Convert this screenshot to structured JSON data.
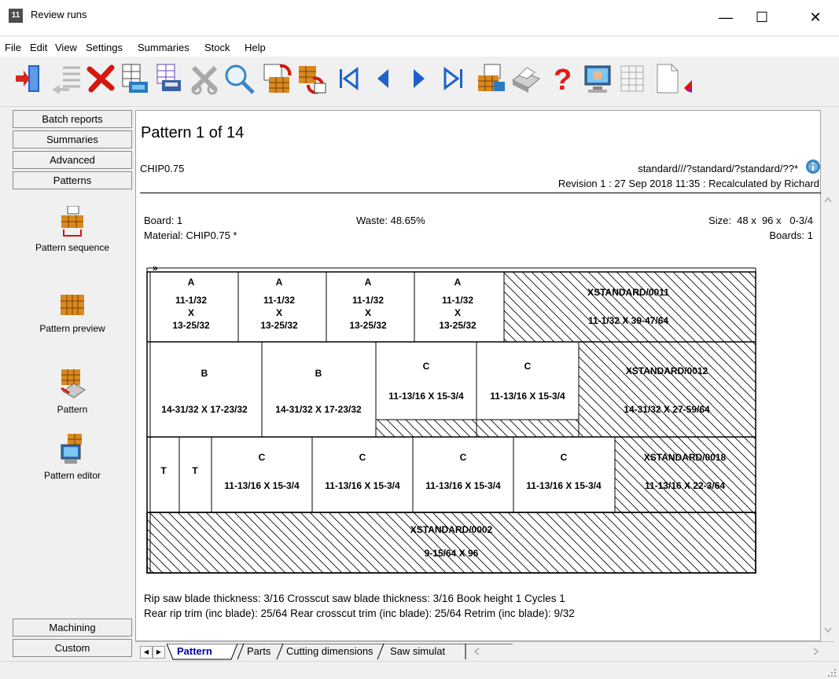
{
  "window": {
    "title": "Review runs",
    "app_icon_text": "11",
    "controls": {
      "minimize": "—",
      "maximize": "☐",
      "close": "✕"
    }
  },
  "menu": [
    "File",
    "Edit",
    "View",
    "Settings",
    "Summaries",
    "Stock",
    "Help"
  ],
  "toolbar": [
    "exit-icon",
    "list-icon",
    "delete-icon",
    "grid-icon",
    "print-grid-icon",
    "cut-icon",
    "search-icon",
    "recalculate-icon",
    "undo-icon",
    "first-icon",
    "previous-icon",
    "next-icon",
    "last-icon",
    "export-icon",
    "print-icon",
    "help-icon",
    "computer-icon",
    "layout-icon",
    "page-icon",
    "pen-icon"
  ],
  "left_nav": {
    "top_buttons": [
      "Batch reports",
      "Summaries",
      "Advanced",
      "Patterns"
    ],
    "tools": [
      "Pattern sequence",
      "Pattern preview",
      "Pattern",
      "Pattern editor"
    ],
    "bottom_buttons": [
      "Machining",
      "Custom"
    ]
  },
  "report": {
    "pattern_title": "Pattern 1 of 14",
    "material_code": "CHIP0.75",
    "standard_path": "standard///?standard/?standard/??*",
    "revision": "Revision 1 : 27 Sep 2018 11:35 : Recalculated by Richard",
    "board": "Board: 1",
    "waste": "Waste: 48.65%",
    "size": "Size:  48 x  96 x   0-3/4",
    "material": "Material: CHIP0.75 *",
    "boards": "Boards: 1",
    "footer_line1": "Rip saw blade thickness: 3/16  Crosscut saw blade thickness: 3/16  Book height 1  Cycles 1",
    "footer_line2": "Rear rip trim (inc blade): 25/64 Rear crosscut trim (inc blade): 25/64 Retrim (inc blade): 9/32"
  },
  "pattern": {
    "arrow": "»",
    "row1": {
      "parts": [
        {
          "label": "A",
          "w": "11-1/32",
          "x": "X",
          "h": "13-25/32"
        },
        {
          "label": "A",
          "w": "11-1/32",
          "x": "X",
          "h": "13-25/32"
        },
        {
          "label": "A",
          "w": "11-1/32",
          "x": "X",
          "h": "13-25/32"
        },
        {
          "label": "A",
          "w": "11-1/32",
          "x": "X",
          "h": "13-25/32"
        }
      ],
      "waste": {
        "label": "XSTANDARD/0011",
        "dims": "11-1/32 X 39-47/64"
      }
    },
    "row2": {
      "b_parts": [
        {
          "label": "B",
          "dims": "14-31/32 X 17-23/32"
        },
        {
          "label": "B",
          "dims": "14-31/32 X 17-23/32"
        }
      ],
      "c_parts": [
        {
          "label": "C",
          "dims": "11-13/16 X 15-3/4"
        },
        {
          "label": "C",
          "dims": "11-13/16 X 15-3/4"
        }
      ],
      "waste": {
        "label": "XSTANDARD/0012",
        "dims": "14-31/32 X 27-59/64"
      }
    },
    "row3": {
      "t_parts": [
        "T",
        "T"
      ],
      "c_parts": [
        {
          "label": "C",
          "dims": "11-13/16 X 15-3/4"
        },
        {
          "label": "C",
          "dims": "11-13/16 X 15-3/4"
        },
        {
          "label": "C",
          "dims": "11-13/16 X 15-3/4"
        },
        {
          "label": "C",
          "dims": "11-13/16 X 15-3/4"
        }
      ],
      "waste": {
        "label": "XSTANDARD/0018",
        "dims": "11-13/16 X 22-3/64"
      }
    },
    "bottom_waste": {
      "label": "XSTANDARD/0002",
      "dims": "9-15/64 X 96"
    }
  },
  "tabs": [
    "Pattern",
    "Parts",
    "Cutting dimensions",
    "Saw simulat"
  ],
  "colors": {
    "selected_tab_text": "#0000a0",
    "info_icon": "#3a86c8"
  }
}
